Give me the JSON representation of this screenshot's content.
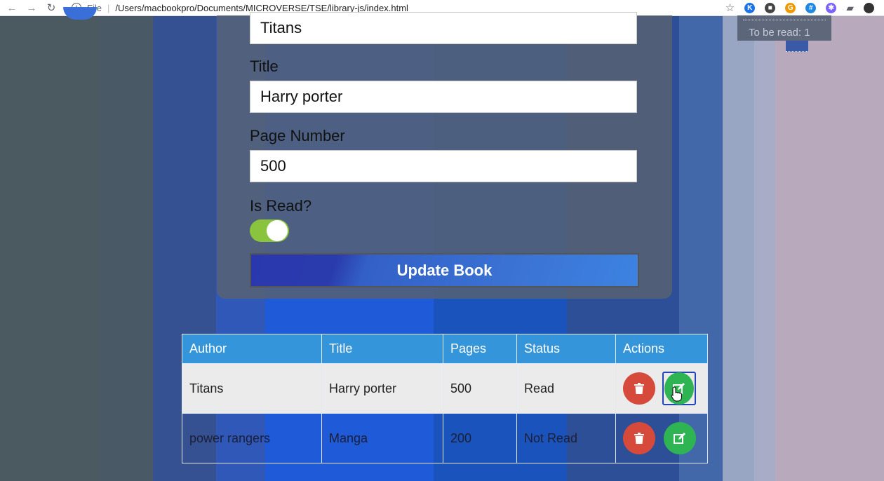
{
  "browser": {
    "scheme": "File",
    "url": "/Users/macbookpro/Documents/MICROVERSE/TSE/library-js/index.html"
  },
  "form": {
    "author_value": "Titans",
    "title_label": "Title",
    "title_value": "Harry porter",
    "pages_label": "Page Number",
    "pages_value": "500",
    "read_label": "Is Read?",
    "read_toggle_on": true,
    "submit_label": "Update Book"
  },
  "counter": {
    "to_be_read": "To be read: 1"
  },
  "table": {
    "headers": [
      "Author",
      "Title",
      "Pages",
      "Status",
      "Actions"
    ],
    "rows": [
      {
        "author": "Titans",
        "title": "Harry porter",
        "pages": "500",
        "status": "Read"
      },
      {
        "author": "power rangers",
        "title": "Manga",
        "pages": "200",
        "status": "Not Read"
      }
    ]
  },
  "icons": {
    "delete": "trash-icon",
    "edit": "edit-icon"
  },
  "colors": {
    "header": "#3595da",
    "delete": "#d64a3b",
    "edit": "#2fb453",
    "toggle": "#8ac43f"
  }
}
